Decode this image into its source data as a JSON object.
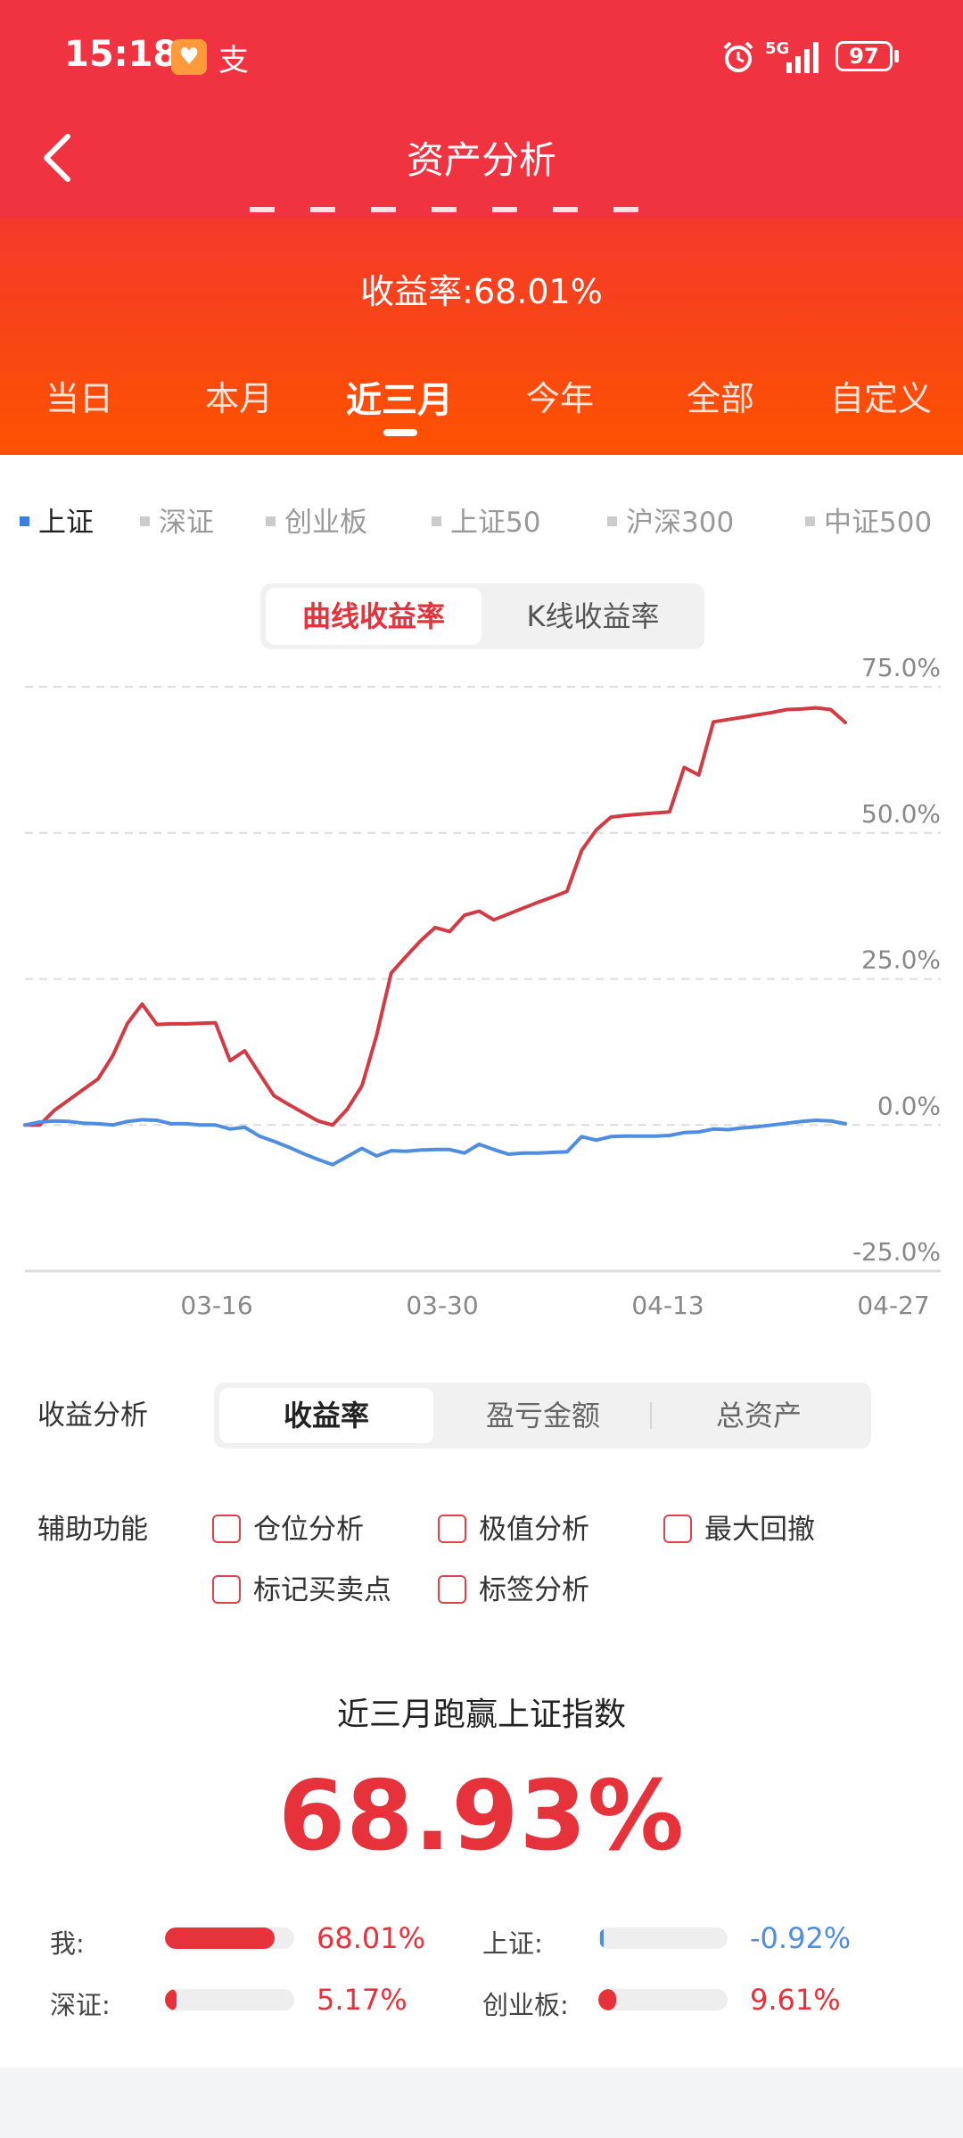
{
  "status": {
    "time": "15:18",
    "network": "5G",
    "battery": "97"
  },
  "header": {
    "title": "资产分析"
  },
  "summary": {
    "return_rate": "收益率:68.01%",
    "periods": [
      "当日",
      "本月",
      "近三月",
      "今年",
      "全部",
      "自定义"
    ],
    "active_period": 2
  },
  "indices": [
    "上证",
    "深证",
    "创业板",
    "上证50",
    "沪深300",
    "中证500"
  ],
  "chart_modes": {
    "curve": "曲线收益率",
    "kline": "K线收益率"
  },
  "chart_data": {
    "type": "line",
    "y_axis_position": "right",
    "grid": "dashed horizontal",
    "ylim": [
      -25,
      75
    ],
    "yticks": [
      "75.0%",
      "50.0%",
      "25.0%",
      "0.0%",
      "-25.0%"
    ],
    "xticks": [
      "03-16",
      "03-30",
      "04-13",
      "04-27"
    ],
    "series": [
      {
        "color": "#d23b43",
        "values": [
          0.0,
          0.0,
          2.5,
          4.3,
          6.1,
          7.9,
          11.9,
          17.4,
          20.7,
          17.2,
          17.3,
          17.3,
          17.4,
          17.5,
          11.0,
          12.7,
          8.8,
          5.0,
          3.5,
          2.1,
          0.7,
          0.0,
          2.7,
          6.7,
          15.3,
          26.0,
          28.8,
          31.5,
          33.8,
          33.1,
          35.9,
          36.6,
          35.1,
          36.1,
          37.1,
          38.1,
          39.0,
          40.0,
          47.0,
          50.5,
          52.7,
          53.0,
          53.2,
          53.4,
          53.6,
          61.2,
          59.9,
          69.0,
          69.4,
          69.8,
          70.2,
          70.6,
          71.1,
          71.2,
          71.4,
          71.1,
          68.9
        ]
      },
      {
        "color": "#4f8de0",
        "values": [
          0.0,
          0.5,
          0.7,
          0.6,
          0.3,
          0.2,
          0.0,
          0.6,
          0.9,
          0.8,
          0.2,
          0.2,
          0.0,
          0.0,
          -0.7,
          -0.4,
          -1.9,
          -2.8,
          -3.8,
          -4.9,
          -5.9,
          -6.8,
          -5.4,
          -4.0,
          -5.3,
          -4.4,
          -4.5,
          -4.3,
          -4.2,
          -4.2,
          -4.8,
          -3.3,
          -4.2,
          -5.0,
          -4.8,
          -4.8,
          -4.7,
          -4.6,
          -2.0,
          -2.6,
          -2.0,
          -1.9,
          -1.9,
          -1.9,
          -1.8,
          -1.3,
          -1.2,
          -0.7,
          -0.8,
          -0.5,
          -0.3,
          0.0,
          0.3,
          0.6,
          0.8,
          0.7,
          0.2
        ]
      }
    ]
  },
  "analysis": {
    "label": "收益分析",
    "tabs": [
      "收益率",
      "盈亏金额",
      "总资产"
    ],
    "active": 0
  },
  "aux": {
    "label": "辅助功能",
    "options": [
      "仓位分析",
      "极值分析",
      "最大回撤",
      "标记买卖点",
      "标签分析"
    ]
  },
  "beat": {
    "title": "近三月跑赢上证指数",
    "value": "68.93%"
  },
  "comparison": [
    {
      "label": "我:",
      "value": "68.01%",
      "fill": 0.85,
      "color": "#e5323b"
    },
    {
      "label": "上证:",
      "value": "-0.92%",
      "fill": 0.02,
      "color": "#4f8de0"
    },
    {
      "label": "深证:",
      "value": "5.17%",
      "fill": 0.09,
      "color": "#e5323b"
    },
    {
      "label": "创业板:",
      "value": "9.61%",
      "fill": 0.14,
      "color": "#e5323b"
    }
  ]
}
